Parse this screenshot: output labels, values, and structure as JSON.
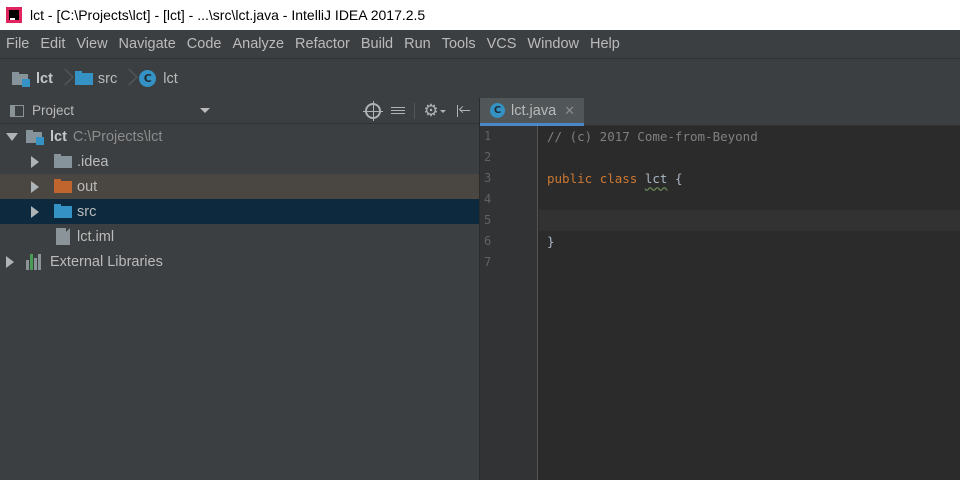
{
  "window": {
    "title": "lct - [C:\\Projects\\lct] - [lct] - ...\\src\\lct.java - IntelliJ IDEA 2017.2.5"
  },
  "menubar": {
    "items": [
      "File",
      "Edit",
      "View",
      "Navigate",
      "Code",
      "Analyze",
      "Refactor",
      "Build",
      "Run",
      "Tools",
      "VCS",
      "Window",
      "Help"
    ]
  },
  "breadcrumb": {
    "items": [
      {
        "label": "lct",
        "icon": "module-folder-icon"
      },
      {
        "label": "src",
        "icon": "source-folder-icon"
      },
      {
        "label": "lct",
        "icon": "class-icon"
      }
    ]
  },
  "project_panel": {
    "title": "Project",
    "tree": [
      {
        "label": "lct",
        "path": "C:\\Projects\\lct",
        "icon": "module-folder-icon",
        "expanded": true
      },
      {
        "label": ".idea",
        "icon": "folder-icon",
        "color": "#87939a"
      },
      {
        "label": "out",
        "icon": "folder-icon",
        "color": "#c1652f"
      },
      {
        "label": "src",
        "icon": "folder-icon",
        "color": "#3592c4",
        "selected": true
      },
      {
        "label": "lct.iml",
        "icon": "file-icon"
      },
      {
        "label": "External Libraries",
        "icon": "libraries-icon"
      }
    ]
  },
  "editor": {
    "tab_label": "lct.java",
    "tab_close": "✕",
    "class_icon_letter": "C",
    "line_numbers": [
      "1",
      "2",
      "3",
      "4",
      "5",
      "6",
      "7"
    ],
    "code": {
      "line1_comment": "// (c) 2017 Come-from-Beyond",
      "line3_kw1": "public",
      "line3_kw2": "class",
      "line3_name": "lct",
      "line3_brace": "{",
      "line6_brace": "}"
    }
  },
  "colors": {
    "accent": "#4a88c7",
    "keyword": "#cc7832",
    "comment": "#808080",
    "selection": "#0d293e"
  }
}
